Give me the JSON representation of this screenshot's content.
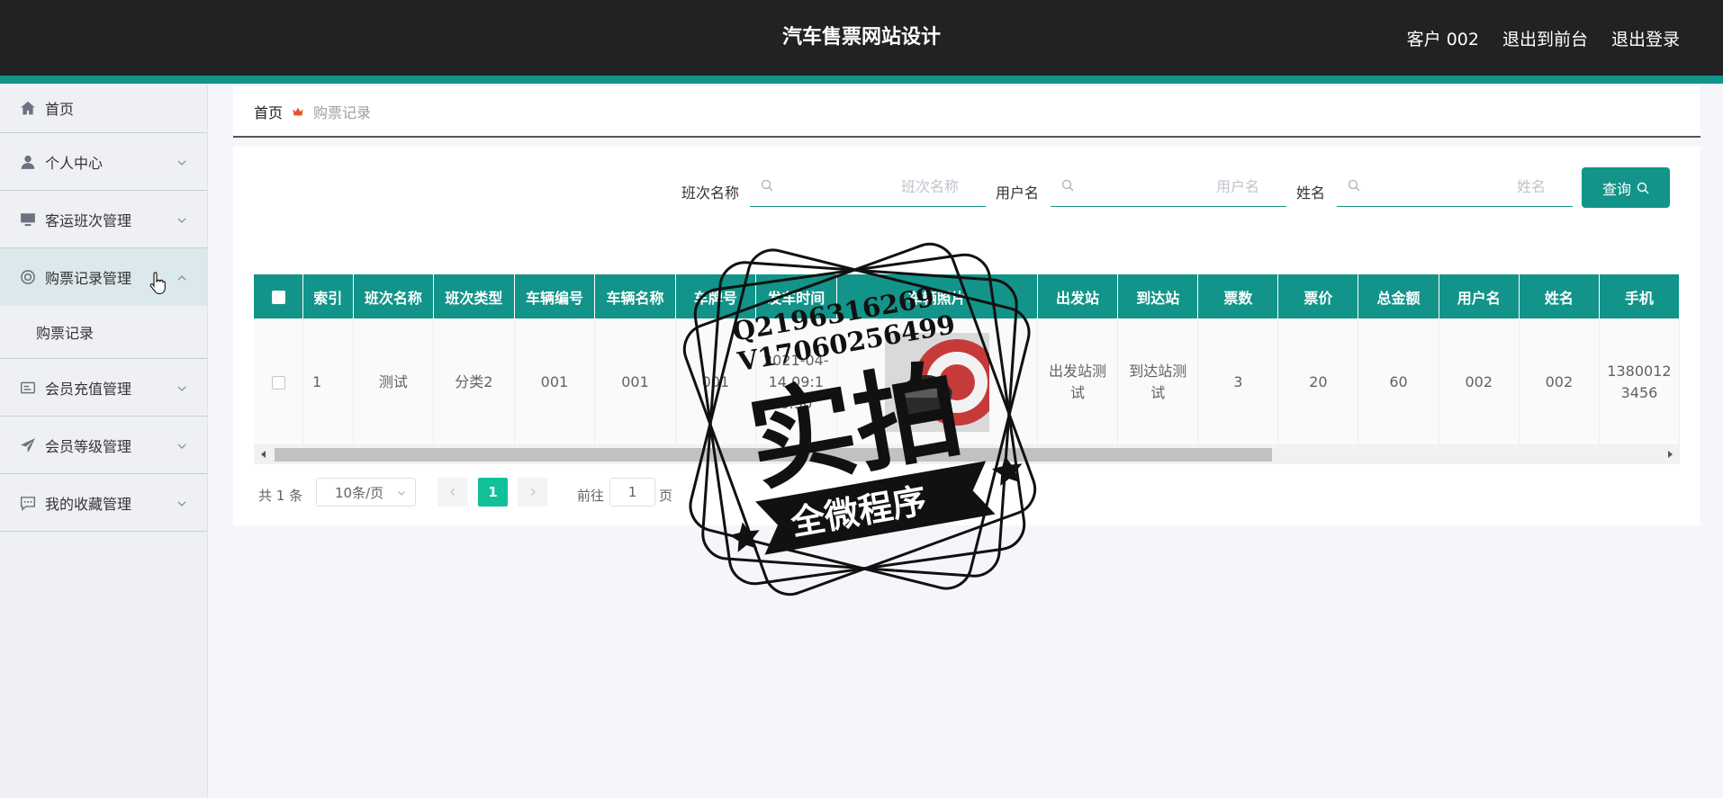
{
  "app": {
    "title": "汽车售票网站设计",
    "user": "客户 002",
    "front_link": "退出到前台",
    "logout": "退出登录"
  },
  "sidebar": {
    "items": [
      {
        "label": "首页",
        "icon": "home-icon"
      },
      {
        "label": "个人中心",
        "icon": "user-icon"
      },
      {
        "label": "客运班次管理",
        "icon": "monitor-icon"
      },
      {
        "label": "购票记录管理",
        "icon": "lifebuoy-icon"
      },
      {
        "label": "会员充值管理",
        "icon": "card-icon"
      },
      {
        "label": "会员等级管理",
        "icon": "send-icon"
      },
      {
        "label": "我的收藏管理",
        "icon": "chat-icon"
      }
    ],
    "submenu": {
      "label": "购票记录"
    }
  },
  "breadcrumb": {
    "home": "首页",
    "current": "购票记录"
  },
  "search": {
    "shift_label": "班次名称",
    "shift_placeholder": "班次名称",
    "user_label": "用户名",
    "user_placeholder": "用户名",
    "name_label": "姓名",
    "name_placeholder": "姓名",
    "query_button": "查询"
  },
  "table": {
    "columns": [
      "索引",
      "班次名称",
      "班次类型",
      "车辆编号",
      "车辆名称",
      "车牌号",
      "发车时间",
      "车辆照片",
      "出发站",
      "到达站",
      "票数",
      "票价",
      "总金额",
      "用户名",
      "姓名",
      "手机"
    ],
    "rows": [
      {
        "index": "1",
        "shift_name": "测试",
        "shift_type": "分类2",
        "vehicle_no": "001",
        "vehicle_name": "001",
        "plate": "001",
        "depart_time": "2021-04-14 09:18:50",
        "departure": "出发站测试",
        "arrival": "到达站测试",
        "tickets": "3",
        "price": "20",
        "total": "60",
        "username": "002",
        "name": "002",
        "phone": "13800123456"
      }
    ]
  },
  "pagination": {
    "total": "共 1 条",
    "page_size": "10条/页",
    "current": "1",
    "goto_label": "前往",
    "goto_value": "1",
    "page_suffix": "页"
  },
  "watermark": {
    "line1": "Q2196316269",
    "line2": "V17060256499",
    "main": "实拍",
    "ribbon": "全微程序"
  },
  "colors": {
    "accent": "#12948a",
    "topbar": "#222222",
    "pager_active": "#12c09a"
  }
}
